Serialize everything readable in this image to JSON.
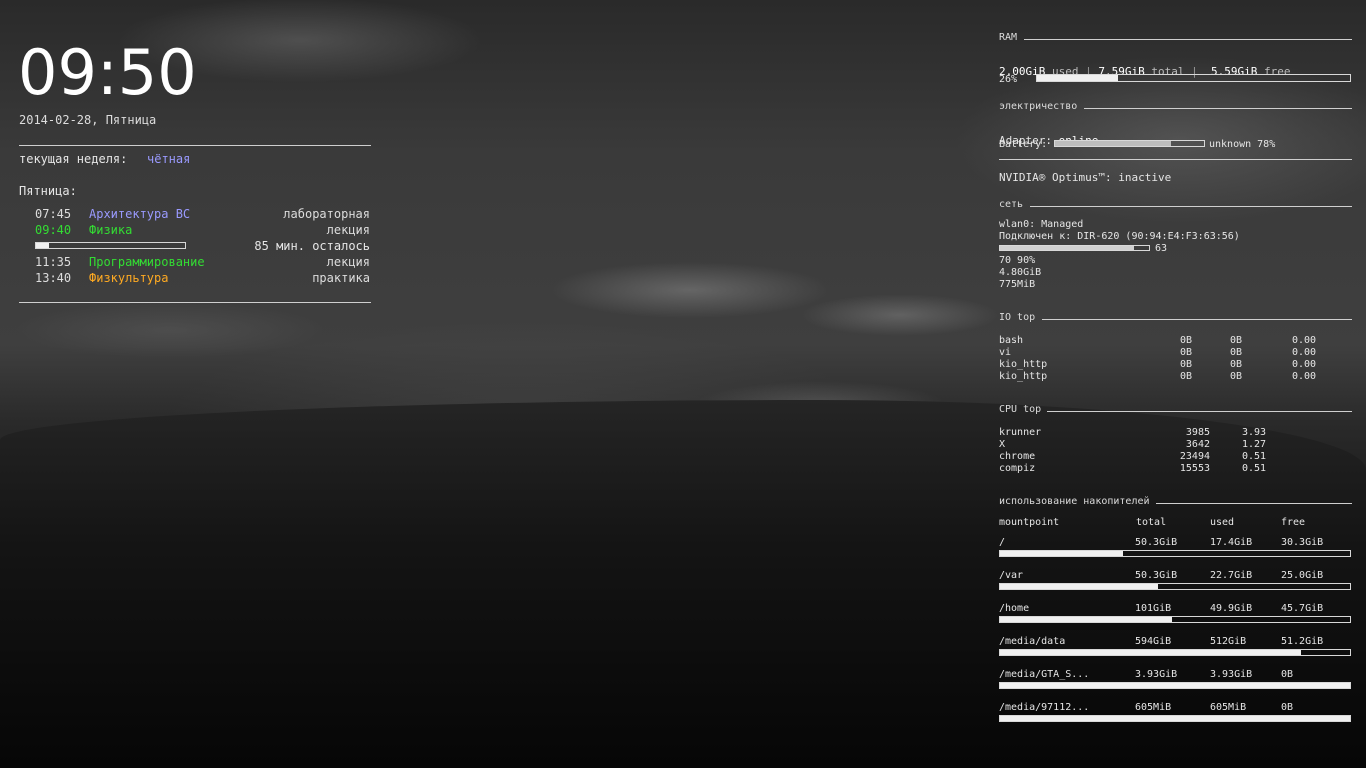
{
  "clock": {
    "time": "09:50",
    "date": "2014-02-28, Пятница"
  },
  "schedule": {
    "week_label": "текущая неделя:",
    "week_value": "чётная",
    "day_title": "Пятница:",
    "lessons": [
      {
        "time": "07:45",
        "name": "Архитектура ВС",
        "type": "лабораторная",
        "color": "#9a9aff"
      },
      {
        "time": "09:40",
        "name": "Физика",
        "type": "лекция",
        "color": "#33dd33"
      },
      {
        "time": "11:35",
        "name": "Программирование",
        "type": "лекция",
        "color": "#33dd33"
      },
      {
        "time": "13:40",
        "name": "Физкультура",
        "type": "практика",
        "color": "#ffaa22"
      }
    ],
    "progress_text": "85 мин. осталось",
    "progress_fraction": 0.09
  },
  "ram": {
    "title": "RAM",
    "used": "2.00GiB",
    "used_label": "used",
    "total": "7.59GiB",
    "total_label": "total",
    "free": "5.59GiB",
    "free_label": "free",
    "sep": "|",
    "percent": "26%",
    "fraction": 0.26
  },
  "power": {
    "title": "электричество",
    "adapter_label": "Adapter:",
    "adapter_value": "online",
    "battery_label": "Battery:",
    "battery_status": "unknown 78%",
    "battery_fraction": 0.78
  },
  "nvidia": {
    "text": "NVIDIA® Optimus™: inactive"
  },
  "network": {
    "title": "сеть",
    "iface": "wlan0: Managed",
    "connected": "Подключен к: DIR-620 (90:94:E4:F3:63:56)",
    "signal_value": "63",
    "signal_fraction": 0.9,
    "quality": "70 90%",
    "down_total": "4.80GiB",
    "up_total": "775MiB"
  },
  "io_top": {
    "title": "IO top",
    "rows": [
      {
        "name": "bash",
        "read": "0B",
        "write": "0B",
        "pct": "0.00"
      },
      {
        "name": "vi",
        "read": "0B",
        "write": "0B",
        "pct": "0.00"
      },
      {
        "name": "kio_http",
        "read": "0B",
        "write": "0B",
        "pct": "0.00"
      },
      {
        "name": "kio_http",
        "read": "0B",
        "write": "0B",
        "pct": "0.00"
      }
    ]
  },
  "cpu_top": {
    "title": "CPU top",
    "rows": [
      {
        "name": "krunner",
        "pid": "3985",
        "pct": "3.93"
      },
      {
        "name": "X",
        "pid": "3642",
        "pct": "1.27"
      },
      {
        "name": "chrome",
        "pid": "23494",
        "pct": "0.51"
      },
      {
        "name": "compiz",
        "pid": "15553",
        "pct": "0.51"
      }
    ]
  },
  "storage": {
    "title": "использование накопителей",
    "headers": {
      "mount": "mountpoint",
      "total": "total",
      "used": "used",
      "free": "free"
    },
    "rows": [
      {
        "mount": "/",
        "total": "50.3GiB",
        "used": "17.4GiB",
        "free": "30.3GiB",
        "fraction": 0.35
      },
      {
        "mount": "/var",
        "total": "50.3GiB",
        "used": "22.7GiB",
        "free": "25.0GiB",
        "fraction": 0.45
      },
      {
        "mount": "/home",
        "total": "101GiB",
        "used": "49.9GiB",
        "free": "45.7GiB",
        "fraction": 0.49
      },
      {
        "mount": "/media/data",
        "total": "594GiB",
        "used": "512GiB",
        "free": "51.2GiB",
        "fraction": 0.86
      },
      {
        "mount": "/media/GTA_S...",
        "total": "3.93GiB",
        "used": "3.93GiB",
        "free": "0B",
        "fraction": 1.0
      },
      {
        "mount": "/media/97112...",
        "total": "605MiB",
        "used": "605MiB",
        "free": "0B",
        "fraction": 1.0
      }
    ]
  }
}
